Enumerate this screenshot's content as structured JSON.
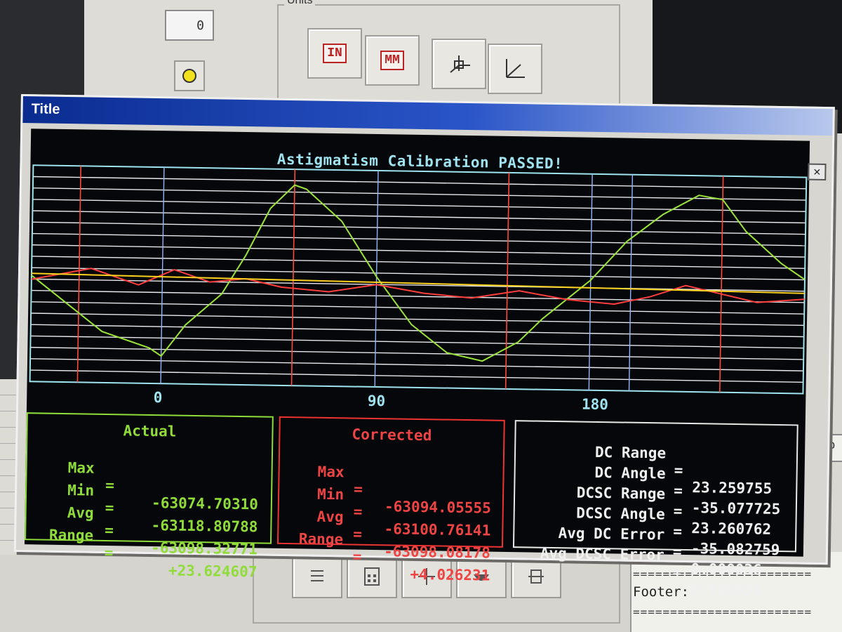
{
  "background": {
    "counter_value": "0",
    "units_group_label": "Units",
    "units_buttons": [
      {
        "name": "in-unit-button",
        "label": "IN"
      },
      {
        "name": "mm-unit-button",
        "label": "MM"
      },
      {
        "name": "3d-axes-icon",
        "label": ""
      },
      {
        "name": "2d-axes-icon",
        "label": ""
      }
    ],
    "footer_label": "Footer:",
    "footer_rule": "========================",
    "side_box_text": "To",
    "bottom_toolbar_icons": [
      "list-icon",
      "calculator-icon",
      "move-arrows-icon",
      "bowl-icon",
      "gauge-icon"
    ]
  },
  "dialog": {
    "title": "Title",
    "close_label": "×",
    "colors": {
      "grid": "#e8e8ee",
      "grid_border": "#9fe3f0",
      "marker_red": "#ff4a3a",
      "marker_blue": "#8fb6ff",
      "actual": "#9ae33a",
      "corrected": "#ff3e3e",
      "average": "#ffd21f",
      "heading": "#9fe3f0"
    }
  },
  "chart_data": {
    "type": "line",
    "title": "Astigmatism Calibration PASSED!",
    "x_tick_labels": [
      "0",
      "90",
      "180"
    ],
    "x_ticks": [
      0,
      90,
      180
    ],
    "xlim": [
      -55,
      270
    ],
    "ylim": [
      -63125,
      -63070
    ],
    "red_marker_x": [
      -35,
      55,
      145,
      235
    ],
    "series": [
      {
        "name": "Actual",
        "color": "#9ae33a",
        "x": [
          -55,
          -25,
          -5,
          0,
          10,
          25,
          35,
          45,
          55,
          60,
          75,
          90,
          105,
          120,
          135,
          150,
          160,
          180,
          195,
          210,
          225,
          235,
          245,
          260,
          270
        ],
        "y": [
          -63098,
          -63112,
          -63116,
          -63118,
          -63110,
          -63102,
          -63092,
          -63080,
          -63074,
          -63075,
          -63083,
          -63097,
          -63109,
          -63116,
          -63118,
          -63113,
          -63107,
          -63097,
          -63087,
          -63080,
          -63075,
          -63076,
          -63084,
          -63092,
          -63096
        ]
      },
      {
        "name": "Corrected",
        "color": "#ff3e3e",
        "x": [
          -55,
          -30,
          -10,
          5,
          20,
          35,
          50,
          70,
          90,
          110,
          130,
          150,
          170,
          190,
          205,
          220,
          235,
          250,
          270
        ],
        "y": [
          -63099,
          -63096,
          -63100,
          -63096,
          -63099,
          -63098,
          -63100,
          -63101,
          -63099,
          -63101,
          -63102,
          -63100,
          -63102,
          -63103,
          -63101,
          -63098,
          -63100,
          -63102,
          -63101
        ]
      },
      {
        "name": "Average",
        "color": "#ffd21f",
        "x": [
          -55,
          270
        ],
        "y": [
          -63097.5,
          -63099.5
        ]
      }
    ]
  },
  "actual_panel": {
    "heading": "Actual",
    "rows": [
      {
        "key": "Max",
        "eq": "=",
        "value": "-63074.70310"
      },
      {
        "key": "Min",
        "eq": "=",
        "value": "-63118.80788"
      },
      {
        "key": "Avg",
        "eq": "=",
        "value": "-63098.32771"
      },
      {
        "key": "Range",
        "eq": "=",
        "value": "+23.624607"
      }
    ]
  },
  "corrected_panel": {
    "heading": "Corrected",
    "rows": [
      {
        "key": "Max",
        "eq": "=",
        "value": "-63094.05555"
      },
      {
        "key": "Min",
        "eq": "=",
        "value": "-63100.76141"
      },
      {
        "key": "Avg",
        "eq": "=",
        "value": "-63098.08178"
      },
      {
        "key": "Range",
        "eq": "=",
        "value": "+4.026231"
      }
    ]
  },
  "dc_panel": {
    "rows": [
      {
        "key": "DC Range",
        "eq": "=",
        "value": "23.259755"
      },
      {
        "key": "DC Angle",
        "eq": "=",
        "value": "-35.077725"
      },
      {
        "key": "DCSC Range",
        "eq": "=",
        "value": "23.260762"
      },
      {
        "key": "DCSC Angle",
        "eq": "=",
        "value": "-35.082759"
      },
      {
        "key": "Avg DC Error",
        "eq": "=",
        "value": "0.000036"
      },
      {
        "key": "Avg DCSC Error",
        "eq": "=",
        "value": "0.000036"
      }
    ]
  }
}
